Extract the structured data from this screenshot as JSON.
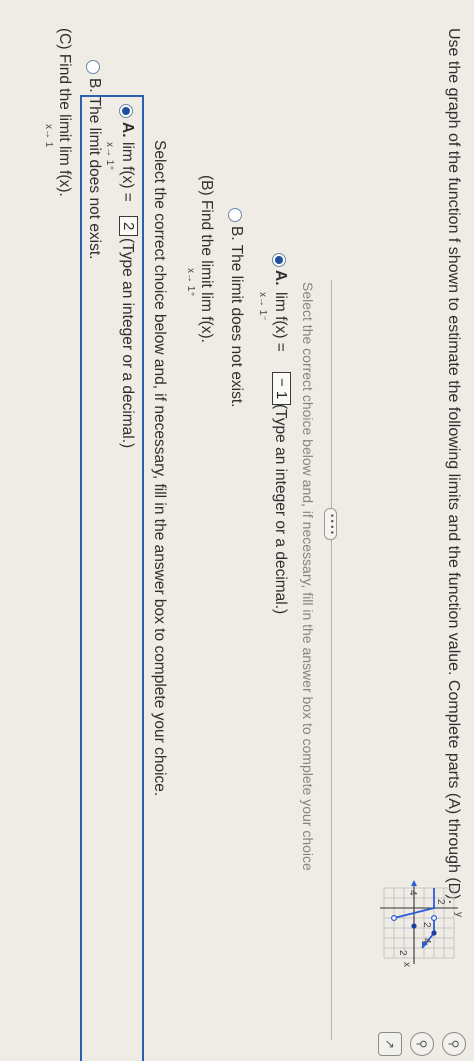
{
  "instruction": "Use the graph of the function f shown to estimate the following limits and the function value. Complete parts (A) through (D).",
  "graph": {
    "y_label": "y",
    "x_label": "x",
    "tick_2_top": "2",
    "tick_4": "4",
    "tick_2_right": "2",
    "tick_4_right": "4",
    "tick_neg2": "2"
  },
  "more_button": "• • • •",
  "select_prompt": "Select the correct choice below and, if necessary, fill in the answer box to complete your choice.",
  "select_prompt_cut": "Select the correct choice below and, if necessary, fill in the answer box to complete your choice",
  "part_a_prev": {
    "choice_a_label": "A.",
    "lim_text": "lim f(x) =",
    "answer": "− 1",
    "sub": "x→ 1⁻",
    "hint": "(Type an integer or a decimal.)",
    "choice_b": "B.  The limit does not exist."
  },
  "part_b_label": "(B) Find the limit  lim f(x).",
  "part_b_sub": "x→ 1⁺",
  "part_b": {
    "choice_a_label": "A.",
    "lim_text": "lim f(x) =",
    "answer": "2",
    "sub": "x→ 1⁺",
    "hint": "(Type an integer or a decimal.)",
    "choice_b": "B.  The limit does not exist."
  },
  "part_c_label": "(C) Find the limit  lim f(x).",
  "part_c_sub": "x→ 1",
  "tools": [
    "zoom-in",
    "zoom-out",
    "popout"
  ]
}
